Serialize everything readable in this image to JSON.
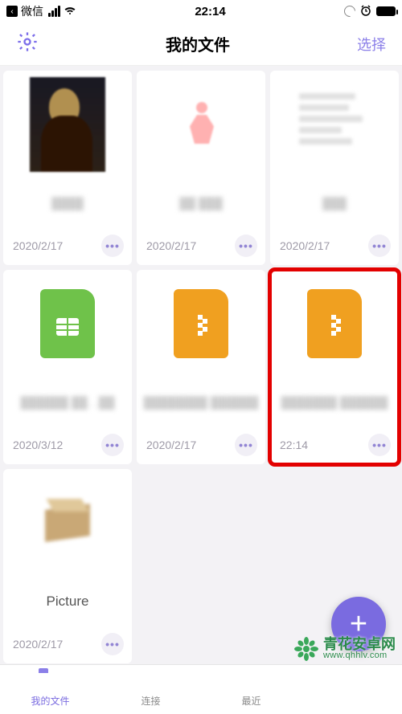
{
  "status": {
    "app": "微信",
    "time": "22:14"
  },
  "nav": {
    "title": "我的文件",
    "select": "选择"
  },
  "files": [
    {
      "name": "████",
      "date": "2020/2/17",
      "thumb": "mona"
    },
    {
      "name": "██ ███",
      "date": "2020/2/17",
      "thumb": "pink"
    },
    {
      "name": "███",
      "date": "2020/2/17",
      "thumb": "textdoc"
    },
    {
      "name": "██████ ██…██",
      "date": "2020/3/12",
      "thumb": "sheet"
    },
    {
      "name": "████████ ██████",
      "date": "2020/2/17",
      "thumb": "zip"
    },
    {
      "name": "███████ ██████",
      "date": "22:14",
      "thumb": "zip",
      "highlighted": true
    },
    {
      "name": "Picture",
      "date": "2020/2/17",
      "thumb": "box",
      "clear": true
    }
  ],
  "tabs": [
    {
      "label": "我的文件",
      "icon": "folder",
      "active": true
    },
    {
      "label": "连接",
      "icon": "wifi",
      "active": false
    },
    {
      "label": "最近",
      "icon": "clock",
      "active": false
    }
  ],
  "watermark": {
    "brand": "青花安卓网",
    "url": "www.qhhlv.com"
  }
}
